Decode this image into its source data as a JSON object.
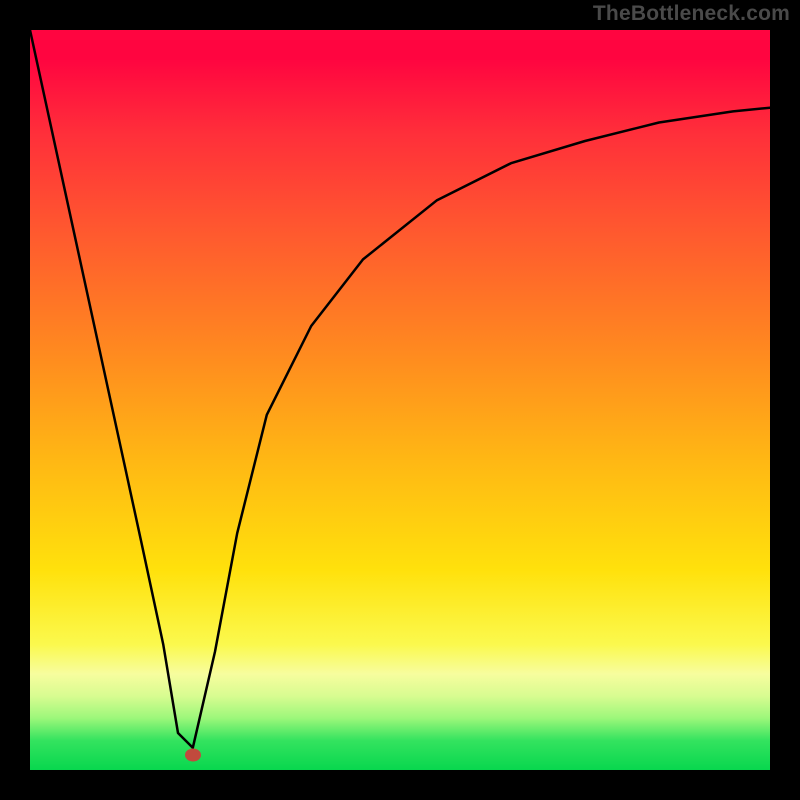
{
  "watermark": "TheBottleneck.com",
  "chart_data": {
    "type": "line",
    "title": "",
    "xlabel": "",
    "ylabel": "",
    "xlim": [
      0,
      100
    ],
    "ylim": [
      0,
      100
    ],
    "grid": false,
    "series": [
      {
        "name": "bottleneck-curve",
        "x": [
          0,
          5,
          10,
          15,
          18,
          20,
          22,
          25,
          28,
          32,
          38,
          45,
          55,
          65,
          75,
          85,
          95,
          100
        ],
        "y": [
          100,
          77,
          54,
          31,
          17,
          5,
          3,
          16,
          32,
          48,
          60,
          69,
          77,
          82,
          85,
          87.5,
          89,
          89.5
        ]
      }
    ],
    "marker": {
      "name": "optimal-point",
      "x": 22,
      "y": 2,
      "color": "#c14a3d"
    },
    "background": {
      "type": "vertical-gradient",
      "stops": [
        {
          "pos": 0,
          "color": "#ff0540"
        },
        {
          "pos": 14,
          "color": "#ff2f3a"
        },
        {
          "pos": 28,
          "color": "#ff5b2e"
        },
        {
          "pos": 44,
          "color": "#ff8b1f"
        },
        {
          "pos": 58,
          "color": "#ffb714"
        },
        {
          "pos": 73,
          "color": "#ffe10c"
        },
        {
          "pos": 83,
          "color": "#fbf94d"
        },
        {
          "pos": 90,
          "color": "#d8fc91"
        },
        {
          "pos": 96,
          "color": "#34e35f"
        },
        {
          "pos": 100,
          "color": "#08d74e"
        }
      ]
    }
  }
}
